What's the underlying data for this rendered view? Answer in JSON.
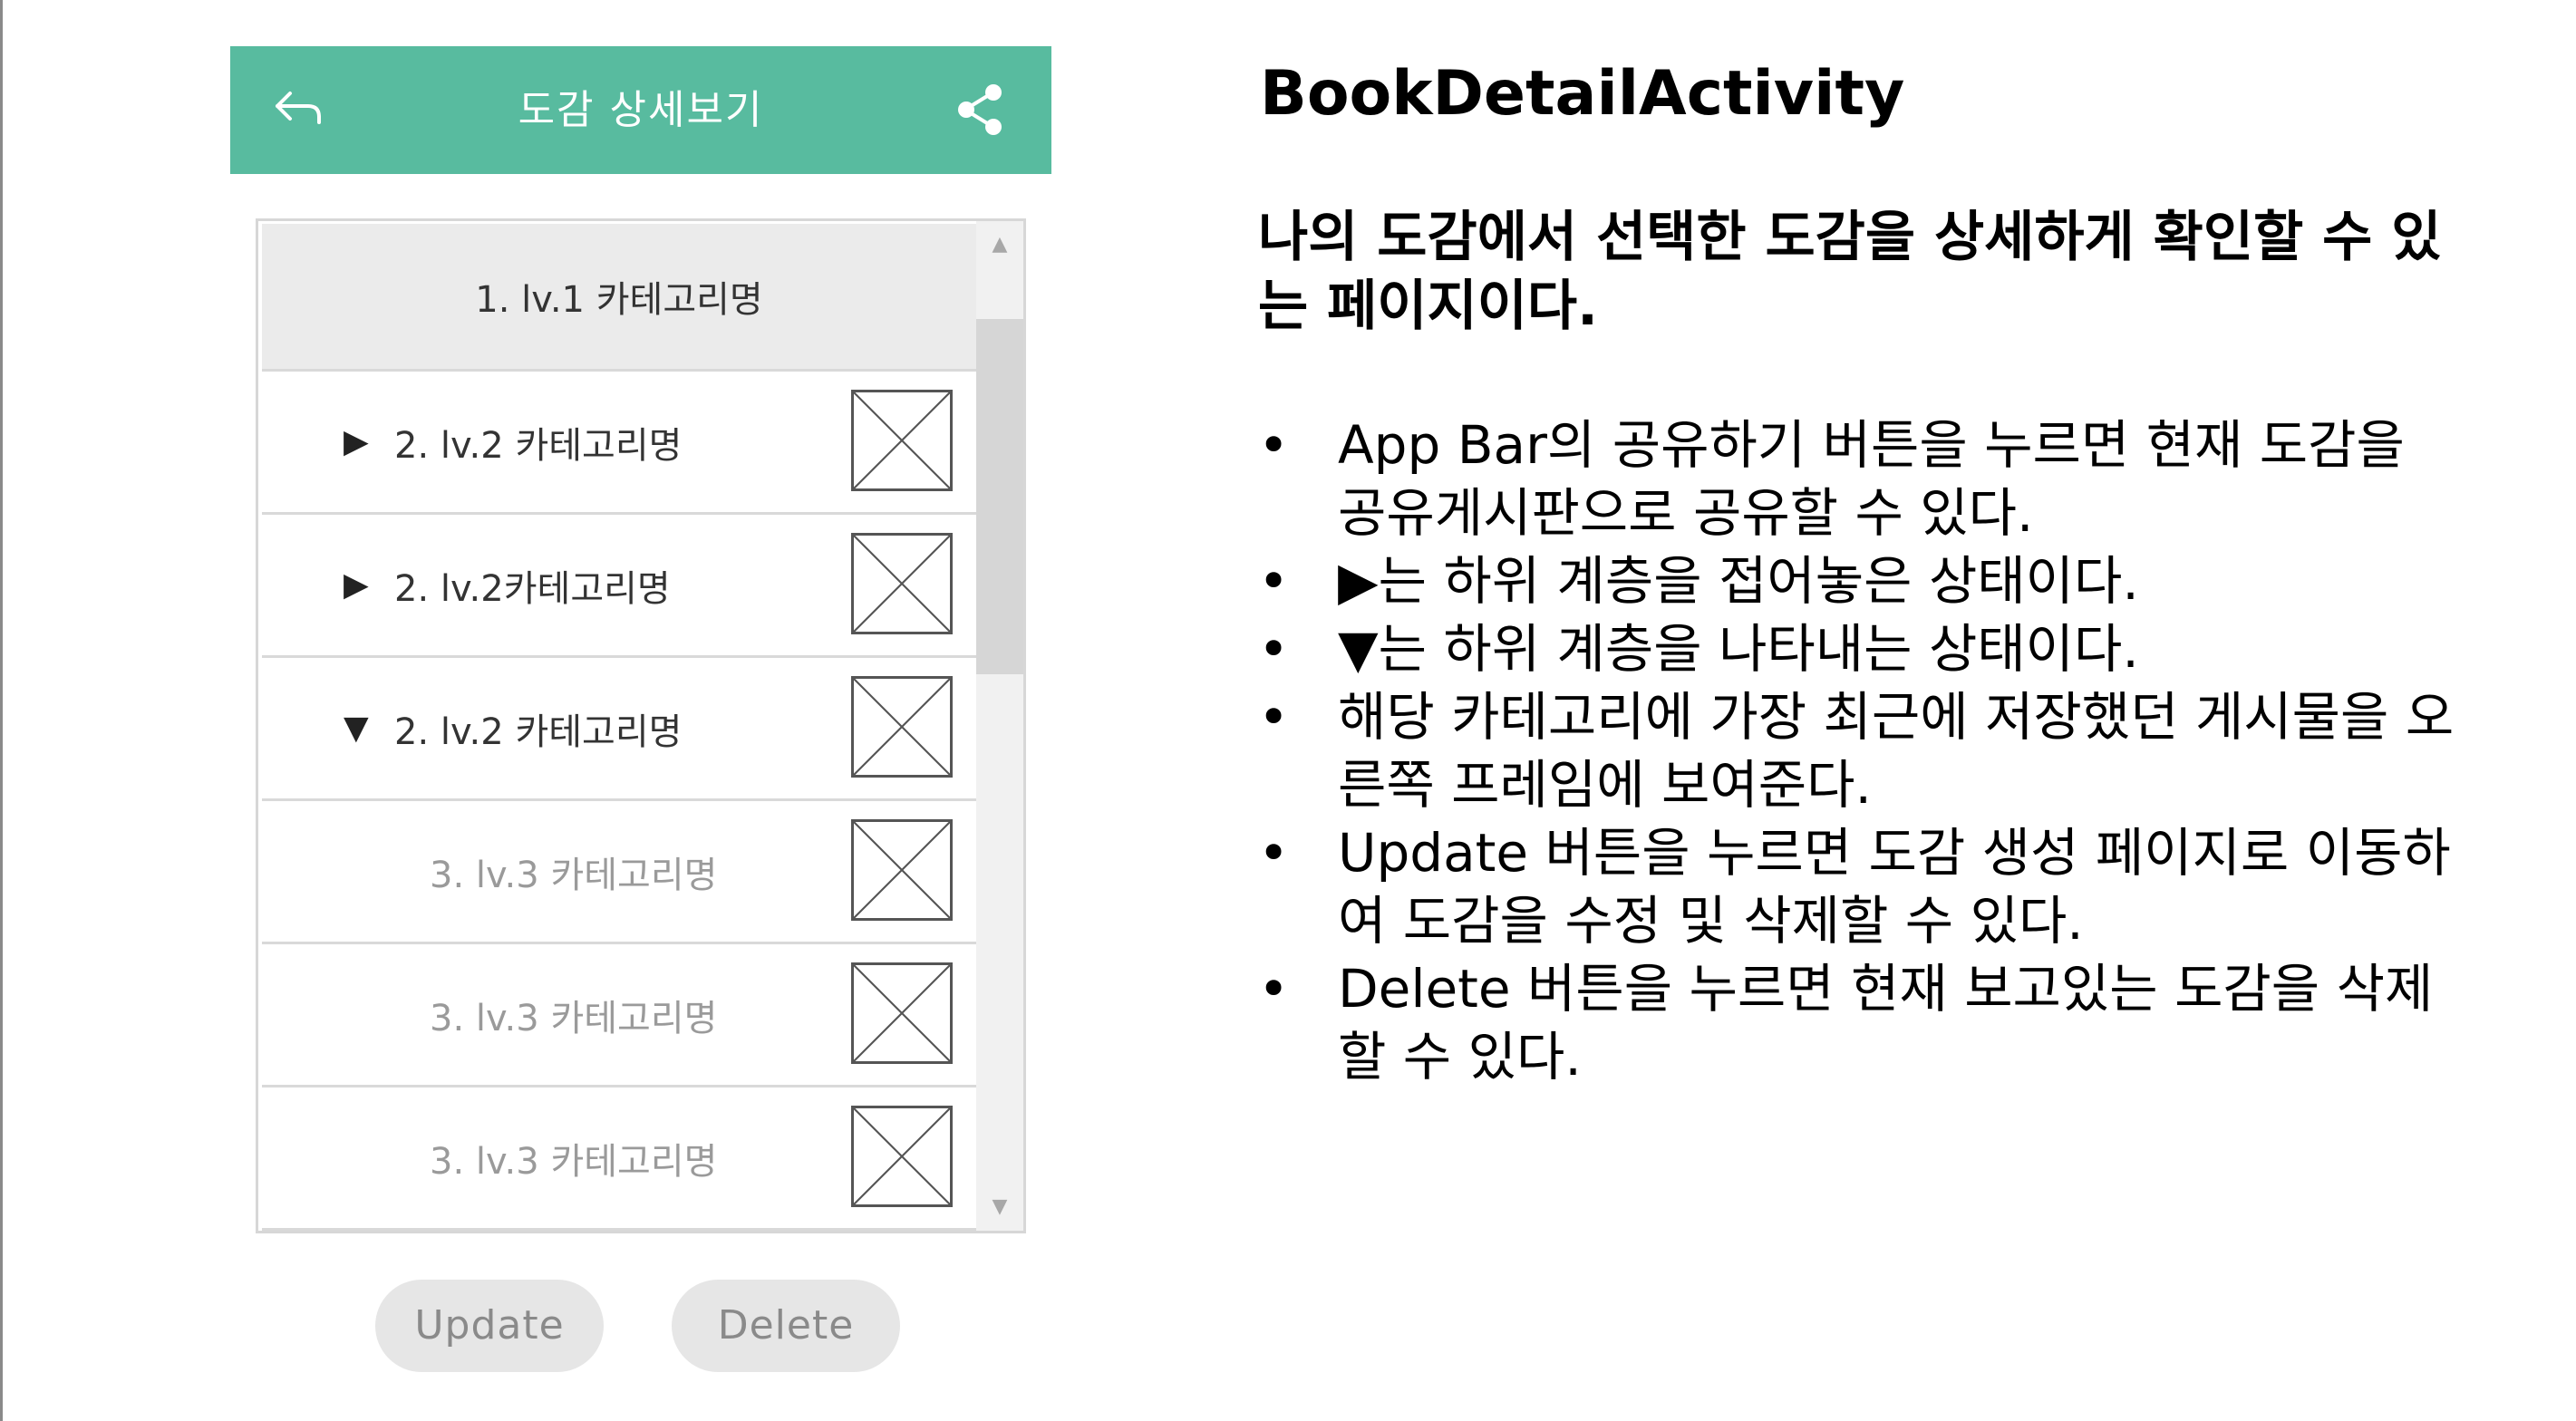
{
  "app_bar": {
    "title": "도감 상세보기",
    "back_icon": "back-arrow-icon",
    "share_icon": "share-icon",
    "color": "#58bb9f"
  },
  "category_list": {
    "level1": "1. lv.1 카테고리명",
    "items": [
      {
        "expander": "▶",
        "label": "2. lv.2 카테고리명"
      },
      {
        "expander": "▶",
        "label": "2. lv.2카테고리명"
      },
      {
        "expander": "▼",
        "label": "2. lv.2 카테고리명"
      },
      {
        "expander": "",
        "label": "3. lv.3 카테고리명"
      },
      {
        "expander": "",
        "label": "3. lv.3 카테고리명"
      },
      {
        "expander": "",
        "label": "3. lv.3 카테고리명"
      }
    ],
    "scroll_up_icon": "▲",
    "scroll_down_icon": "▼"
  },
  "buttons": {
    "update_label": "Update",
    "delete_label": "Delete"
  },
  "description": {
    "activity_name": "BookDetailActivity",
    "summary": "나의 도감에서 선택한 도감을 상세하게 확인할 수 있는 페이지이다.",
    "bullets": [
      "App Bar의 공유하기 버튼을 누르면 현재 도감을 공유게시판으로 공유할 수 있다.",
      "▶는 하위 계층을 접어놓은 상태이다.",
      "▼는 하위 계층을 나타내는 상태이다.",
      "해당 카테고리에 가장 최근에 저장했던 게시물을 오른쪽 프레임에 보여준다.",
      "Update 버튼을 누르면 도감 생성 페이지로 이동하여 도감을 수정 및 삭제할 수 있다.",
      "Delete 버튼을 누르면 현재 보고있는 도감을 삭제할 수 있다."
    ]
  }
}
